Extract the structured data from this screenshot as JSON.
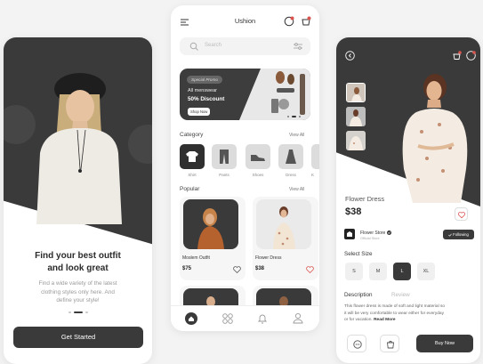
{
  "onboarding": {
    "title_line1": "Find your best outfit",
    "title_line2": "and look great",
    "subtitle_line1": "Find a wide variety of the latest",
    "subtitle_line2": "clothing styles only here. And",
    "subtitle_line3": "define your style!",
    "cta_label": "Get Started"
  },
  "home": {
    "app_name": "Ushion",
    "search_placeholder": "Search",
    "promo": {
      "tag": "Special Promo",
      "line1": "All menswear",
      "line2": "50% Discount",
      "button": "Shop Now"
    },
    "category_title": "Category",
    "view_all": "View All",
    "categories": [
      "Shirt",
      "Pants",
      "Shoes",
      "Dress",
      "K"
    ],
    "popular_title": "Popular",
    "products": [
      {
        "name": "Moslem Outfit",
        "price": "$75"
      },
      {
        "name": "Flower Dress",
        "price": "$38"
      }
    ]
  },
  "detail": {
    "name": "Flower Dress",
    "price": "$38",
    "store_name": "Flower Store",
    "store_status": "Official Store",
    "follow_label": "Following",
    "size_title": "Select Size",
    "sizes": [
      "S",
      "M",
      "L",
      "XL"
    ],
    "selected_size": "L",
    "tab_description": "Description",
    "tab_review": "Review",
    "description_line1": "This flower dress is made of soft and light material so",
    "description_line2": "it will be very comfortable to wear either for everyday",
    "description_line3": "or for vacation.",
    "read_more": "Read More",
    "buy_label": "Buy Now"
  },
  "colors": {
    "dark": "#3a3a3a",
    "accent": "#d9534f",
    "background": "#f3f3f3"
  }
}
